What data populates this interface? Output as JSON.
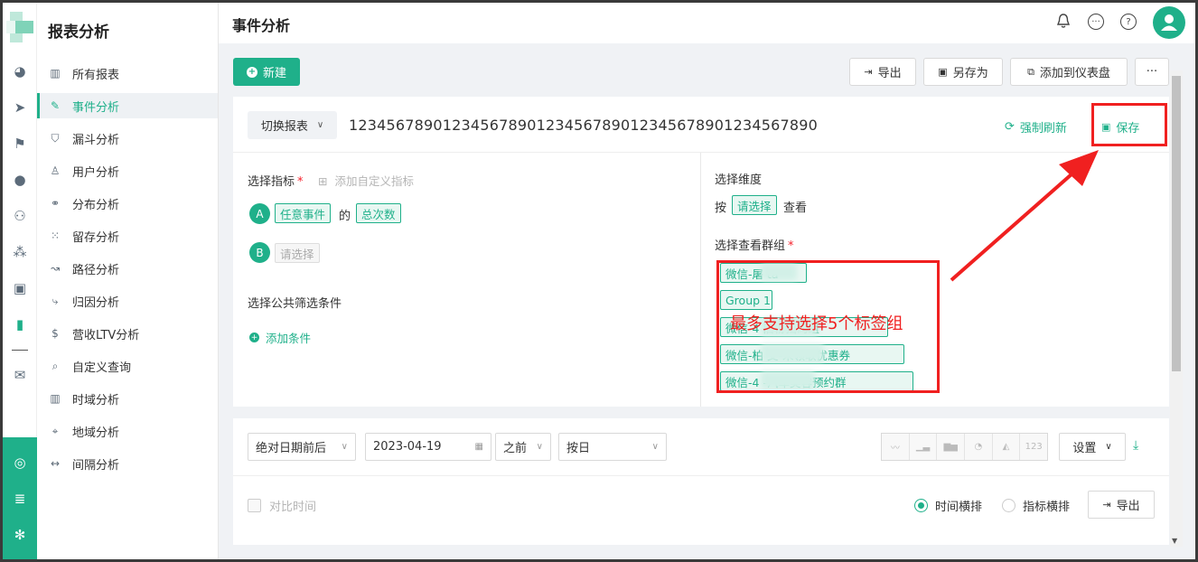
{
  "app": {
    "title": "报表分析"
  },
  "menu": {
    "items": [
      {
        "label": "所有报表",
        "icon": "bar-chart-icon"
      },
      {
        "label": "事件分析",
        "icon": "edit-doc-icon",
        "active": true
      },
      {
        "label": "漏斗分析",
        "icon": "funnel-icon"
      },
      {
        "label": "用户分析",
        "icon": "user-icon"
      },
      {
        "label": "分布分析",
        "icon": "distribution-icon"
      },
      {
        "label": "留存分析",
        "icon": "grid-dots-icon"
      },
      {
        "label": "路径分析",
        "icon": "path-icon"
      },
      {
        "label": "归因分析",
        "icon": "attribution-icon"
      },
      {
        "label": "营收LTV分析",
        "icon": "revenue-icon"
      },
      {
        "label": "自定义查询",
        "icon": "custom-query-icon"
      },
      {
        "label": "时域分析",
        "icon": "time-chart-icon"
      },
      {
        "label": "地域分析",
        "icon": "location-icon"
      },
      {
        "label": "间隔分析",
        "icon": "interval-icon"
      }
    ]
  },
  "header": {
    "title": "事件分析"
  },
  "toolbar": {
    "new_label": "新建",
    "export_label": "导出",
    "save_as_label": "另存为",
    "add_dashboard_label": "添加到仪表盘",
    "more_label": "···"
  },
  "report": {
    "switch_label": "切换报表",
    "name": "12345678901234567890123456789012345678901234567890",
    "refresh_label": "强制刷新",
    "save_label": "保存"
  },
  "metrics": {
    "label": "选择指标",
    "add_custom": "添加自定义指标",
    "a": {
      "badge": "A",
      "event": "任意事件",
      "of": "的",
      "measure": "总次数"
    },
    "b": {
      "badge": "B",
      "placeholder": "请选择"
    },
    "filter_label": "选择公共筛选条件",
    "add_condition": "添加条件"
  },
  "dimension": {
    "label": "选择维度",
    "by": "按",
    "select": "请选择",
    "view": "查看"
  },
  "groups": {
    "label": "选择查看群组",
    "items": [
      {
        "text": "微信-屠        ta"
      },
      {
        "text": "Group 1"
      },
      {
        "text": "微信-4              旧粉扫码组"
      },
      {
        "text": "微信-柏        支-未领取优惠券"
      },
      {
        "text": "微信-4            -汽车美容预约群"
      }
    ]
  },
  "annotation": {
    "text": "最多支持选择5个标签组"
  },
  "query": {
    "date_mode": "绝对日期前后",
    "date": "2023-04-19",
    "direction": "之前",
    "granularity": "按日",
    "settings_label": "设置",
    "chart_icon_123": "123",
    "compare_label": "对比时间",
    "radio_time": "时间横排",
    "radio_metric": "指标横排",
    "export_label": "导出"
  },
  "colors": {
    "brand": "#1fb08a",
    "annotation": "#f02020"
  }
}
